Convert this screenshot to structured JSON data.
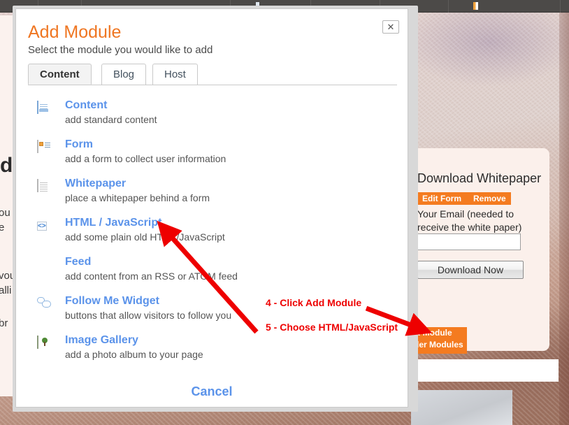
{
  "dialog": {
    "title": "Add Module",
    "subtitle": "Select the module you would like to add",
    "close_label": "✕",
    "cancel_label": "Cancel",
    "tabs": [
      {
        "label": "Content",
        "active": true
      },
      {
        "label": "Blog",
        "active": false
      },
      {
        "label": "Host",
        "active": false
      }
    ],
    "modules": [
      {
        "icon": "page-icon",
        "title": "Content",
        "desc": "add standard content"
      },
      {
        "icon": "form-icon",
        "title": "Form",
        "desc": "add a form to collect user information"
      },
      {
        "icon": "whitepaper-icon",
        "title": "Whitepaper",
        "desc": "place a whitepaper behind a form"
      },
      {
        "icon": "code-icon",
        "title": "HTML / JavaScript",
        "desc": "add some plain old HTML/JavaScript"
      },
      {
        "icon": "rss-icon",
        "title": "Feed",
        "desc": "add content from an RSS or ATOM feed"
      },
      {
        "icon": "speech-bubbles-icon",
        "title": "Follow Me Widget",
        "desc": "buttons that allow visitors to follow you"
      },
      {
        "icon": "image-gallery-icon",
        "title": "Image Gallery",
        "desc": "add a photo album to your page"
      }
    ]
  },
  "sidebar": {
    "title": "Download Whitepaper",
    "edit_form_label": "Edit Form",
    "remove_label": "Remove",
    "field_label": "Your Email (needed to receive the white paper)",
    "email_value": "",
    "email_placeholder": "",
    "download_button": "Download Now"
  },
  "page_behind": {
    "add_module_button": "Add Module",
    "order_modules_button": "Order Modules",
    "left_fragment_big": "d",
    "left_fragments": [
      "ou",
      "e ",
      "vou",
      "alli",
      "br"
    ]
  },
  "annotations": [
    {
      "id": "step4",
      "text": "4 - Click Add Module"
    },
    {
      "id": "step5",
      "text": "5 - Choose HTML/JavaScript"
    }
  ],
  "colors": {
    "title_orange": "#ef7622",
    "link_blue": "#5b93ea",
    "annotation_red": "#ee0000",
    "accent_orange": "#f47b20"
  }
}
